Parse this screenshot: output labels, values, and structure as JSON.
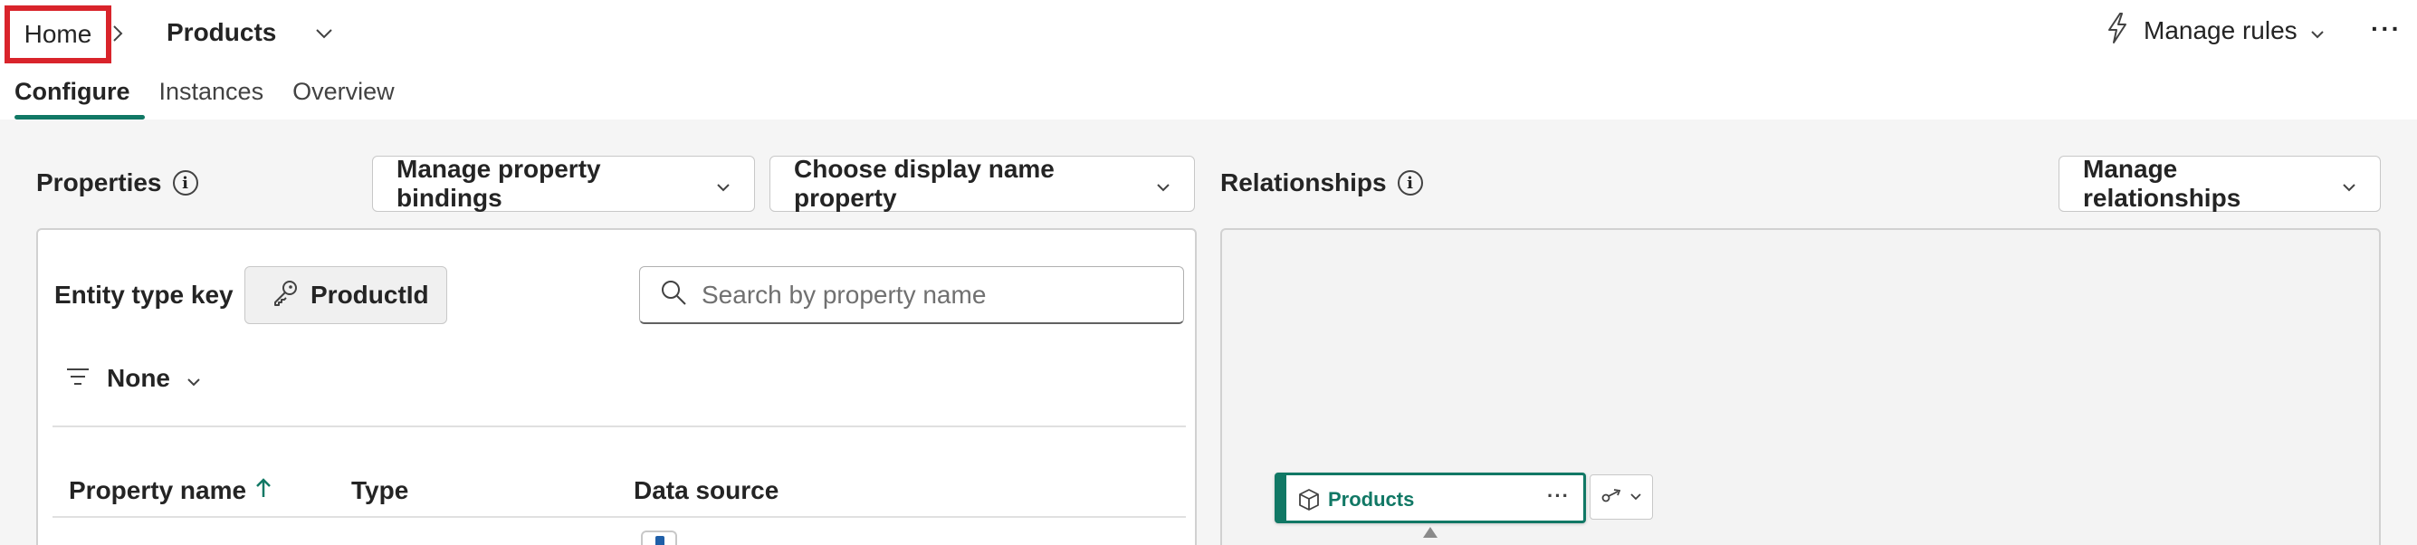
{
  "breadcrumb": {
    "home": "Home",
    "current": "Products"
  },
  "header": {
    "manage_rules": "Manage rules"
  },
  "tabs": [
    {
      "label": "Configure",
      "active": true
    },
    {
      "label": "Instances",
      "active": false
    },
    {
      "label": "Overview",
      "active": false
    }
  ],
  "properties": {
    "title": "Properties",
    "manage_bindings": "Manage property bindings",
    "choose_display": "Choose display name property",
    "entity_key_label": "Entity type key",
    "entity_key_value": "ProductId",
    "search_placeholder": "Search by property name",
    "filter_value": "None",
    "columns": [
      "Property name",
      "Type",
      "Data source"
    ],
    "sort_column": "Property name",
    "sort_direction": "ascending"
  },
  "relationships": {
    "title": "Relationships",
    "manage": "Manage relationships",
    "node_label": "Products"
  },
  "colors": {
    "accent": "#117865",
    "highlight_border": "#d9242b"
  }
}
